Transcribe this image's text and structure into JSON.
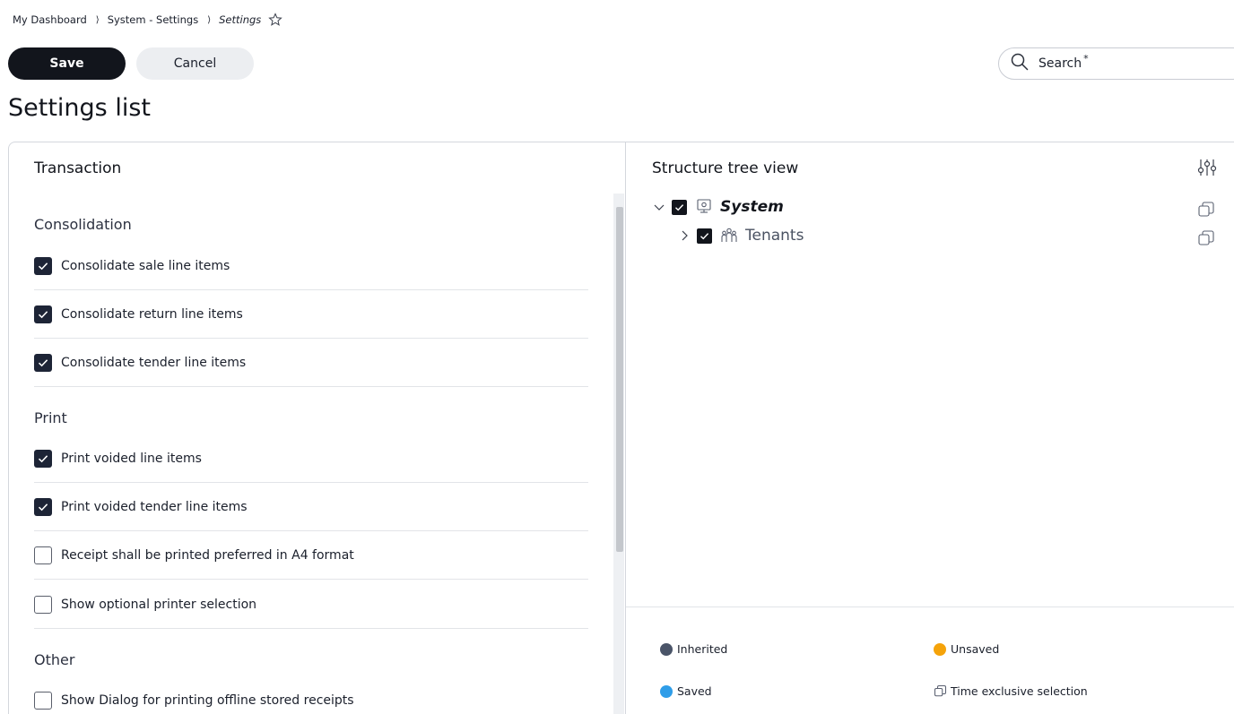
{
  "breadcrumb": {
    "items": [
      "My Dashboard",
      "System - Settings"
    ],
    "current": "Settings",
    "separator": "⟩"
  },
  "toolbar": {
    "save_label": "Save",
    "cancel_label": "Cancel"
  },
  "search": {
    "label": "Search",
    "required_mark": "*"
  },
  "page": {
    "title": "Settings list"
  },
  "left_panel": {
    "heading": "Transaction",
    "groups": [
      {
        "title": "Consolidation",
        "items": [
          {
            "label": "Consolidate sale line items",
            "checked": true
          },
          {
            "label": "Consolidate return line items",
            "checked": true
          },
          {
            "label": "Consolidate tender line items",
            "checked": true
          }
        ]
      },
      {
        "title": "Print",
        "items": [
          {
            "label": "Print voided line items",
            "checked": true
          },
          {
            "label": "Print voided tender line items",
            "checked": true
          },
          {
            "label": "Receipt shall be printed preferred in A4 format",
            "checked": false
          },
          {
            "label": "Show optional printer selection",
            "checked": false
          }
        ]
      },
      {
        "title": "Other",
        "items": [
          {
            "label": "Show Dialog for printing offline stored receipts",
            "checked": false
          }
        ]
      }
    ]
  },
  "tree": {
    "title": "Structure tree view",
    "nodes": [
      {
        "label": "System",
        "icon": "system-icon",
        "expanded": true,
        "checked": true
      },
      {
        "label": "Tenants",
        "icon": "tenants-icon",
        "expanded": false,
        "checked": true
      }
    ]
  },
  "legend": {
    "inherited": "Inherited",
    "unsaved": "Unsaved",
    "saved": "Saved",
    "time_exclusive": "Time exclusive selection"
  },
  "colors": {
    "inherited": "#4a5468",
    "unsaved": "#f5a30a",
    "saved": "#2f9de8",
    "primary": "#12151c"
  }
}
